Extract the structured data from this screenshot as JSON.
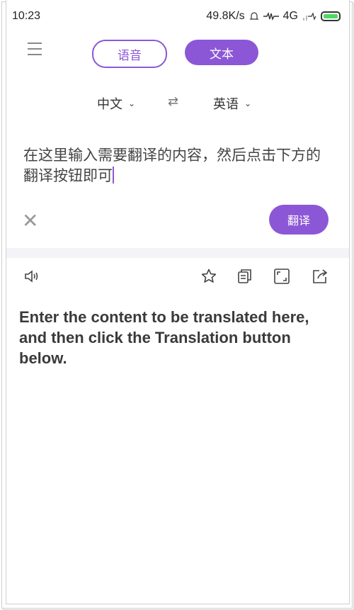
{
  "status_bar": {
    "time": "10:23",
    "speed": "49.8K/s",
    "network": "4G"
  },
  "tabs": [
    {
      "label": "语音"
    },
    {
      "label": "文本"
    }
  ],
  "languages": {
    "source": "中文",
    "target": "英语"
  },
  "input": {
    "text": "在这里输入需要翻译的内容，然后点击下方的翻译按钮即可"
  },
  "actions": {
    "translate_label": "翻译"
  },
  "result": {
    "text": "Enter the content to be translated here, and then click the Translation button below."
  },
  "colors": {
    "accent": "#8c57d6"
  }
}
